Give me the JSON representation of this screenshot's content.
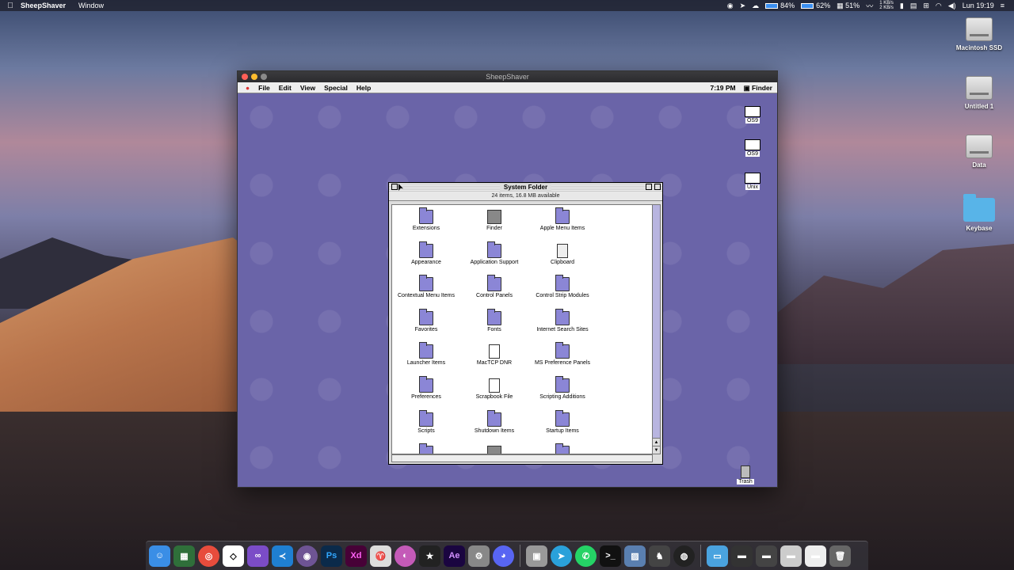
{
  "mac_menubar": {
    "app_name": "SheepShaver",
    "menu_window": "Window",
    "battery1": "84%",
    "battery2": "62%",
    "battery3": "51%",
    "net_up": "1 KB/s",
    "net_down": "2 KB/s",
    "clock": "Lun 19:19"
  },
  "desktop_icons": [
    {
      "label": "Macintosh SSD"
    },
    {
      "label": "Untitled 1"
    },
    {
      "label": "Data"
    },
    {
      "label": "Keybase"
    }
  ],
  "sheepshaver": {
    "title": "SheepShaver",
    "os9_menu": [
      "File",
      "Edit",
      "View",
      "Special",
      "Help"
    ],
    "time": "7:19 PM",
    "app_label": "Finder",
    "volumes": [
      "OS9",
      "OS9",
      "Unix"
    ],
    "trash_label": "Trash",
    "system_folder": {
      "title": "System Folder",
      "info": "24 items, 16.8 MB available",
      "items": [
        {
          "label": "Extensions",
          "kind": "folder"
        },
        {
          "label": "Finder",
          "kind": "app"
        },
        {
          "label": "Apple Menu Items",
          "kind": "folder"
        },
        {
          "label": "Appearance",
          "kind": "folder"
        },
        {
          "label": "Application Support",
          "kind": "folder"
        },
        {
          "label": "Clipboard",
          "kind": "clip"
        },
        {
          "label": "Contextual Menu Items",
          "kind": "folder"
        },
        {
          "label": "Control Panels",
          "kind": "folder"
        },
        {
          "label": "Control Strip Modules",
          "kind": "folder"
        },
        {
          "label": "Favorites",
          "kind": "folder"
        },
        {
          "label": "Fonts",
          "kind": "folder"
        },
        {
          "label": "Internet Search Sites",
          "kind": "folder"
        },
        {
          "label": "Launcher Items",
          "kind": "folder"
        },
        {
          "label": "MacTCP DNR",
          "kind": "doc"
        },
        {
          "label": "MS Preference Panels",
          "kind": "folder"
        },
        {
          "label": "Preferences",
          "kind": "folder"
        },
        {
          "label": "Scrapbook File",
          "kind": "doc"
        },
        {
          "label": "Scripting Additions",
          "kind": "folder"
        },
        {
          "label": "Scripts",
          "kind": "folder"
        },
        {
          "label": "Shutdown Items",
          "kind": "folder"
        },
        {
          "label": "Startup Items",
          "kind": "folder"
        },
        {
          "label": "",
          "kind": "folder"
        },
        {
          "label": "",
          "kind": "app"
        },
        {
          "label": "",
          "kind": "folder"
        }
      ]
    }
  },
  "dock": {
    "ps_label": "Ps",
    "xd_label": "Xd",
    "ae_label": "Ae"
  }
}
